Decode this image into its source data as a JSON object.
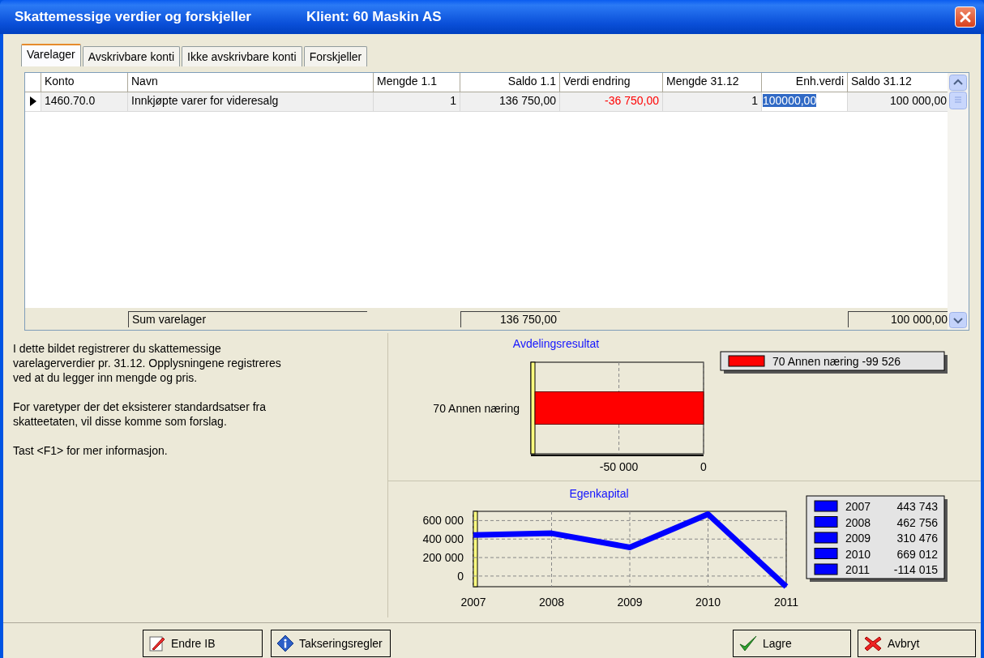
{
  "window": {
    "title": "Skattemessige verdier og forskjeller",
    "client": "Klient: 60  Maskin AS"
  },
  "tabs": [
    {
      "label": "Varelager",
      "selected": true
    },
    {
      "label": "Avskrivbare konti",
      "selected": false
    },
    {
      "label": "Ikke avskrivbare konti",
      "selected": false
    },
    {
      "label": "Forskjeller",
      "selected": false
    }
  ],
  "table": {
    "columns": [
      "Konto",
      "Navn",
      "Mengde 1.1",
      "Saldo 1.1",
      "Verdi endring",
      "Mengde 31.12",
      "Enh.verdi",
      "Saldo 31.12"
    ],
    "rows": [
      {
        "current": true,
        "cells": [
          {
            "text": "1460.70.0",
            "kind": "text"
          },
          {
            "text": "Innkjøpte varer for videresalg",
            "kind": "text"
          },
          {
            "text": "1",
            "kind": "number"
          },
          {
            "text": "136 750,00",
            "kind": "number"
          },
          {
            "text": "-36 750,00",
            "kind": "negative"
          },
          {
            "text": "1",
            "kind": "number"
          },
          {
            "text": "100000,00",
            "kind": "editing"
          },
          {
            "text": "100 000,00",
            "kind": "number"
          }
        ]
      }
    ],
    "footer": {
      "label": "Sum varelager",
      "saldo_1_1": "136 750,00",
      "saldo_31_12": "100 000,00"
    }
  },
  "description": [
    "I dette bildet registrerer du skattemessige varelagerverdier pr. 31.12. Opplysningene registreres ved at du legger inn mengde og pris.",
    "For varetyper der det eksisterer standardsatser fra skatteetaten, vil disse komme som forslag.",
    "Tast <F1> for mer informasjon."
  ],
  "bar_panel": {
    "chart_data": {
      "type": "bar",
      "orientation": "horizontal",
      "title": "Avdelingsresultat",
      "categories": [
        "70 Annen næring"
      ],
      "series": [
        {
          "color": "#ff0000",
          "values": [
            -99526
          ]
        }
      ],
      "xlim": [
        -102000,
        0
      ],
      "xticks": [
        {
          "value": -50000,
          "label": "-50 000"
        },
        0
      ]
    },
    "legend": [
      "70 Annen næring -99 526"
    ]
  },
  "line_panel": {
    "chart_data": {
      "type": "line",
      "title": "Egenkapital",
      "x": [
        "2007",
        "2008",
        "2009",
        "2010",
        "2011"
      ],
      "grid": true,
      "series": [
        {
          "color": "#0000ff",
          "values": [
            443743,
            462756,
            310476,
            669012,
            -114015
          ]
        }
      ],
      "ylim": [
        -115000,
        700000
      ],
      "yticks": [
        0,
        {
          "value": 200000,
          "label": "200 000"
        },
        {
          "value": 400000,
          "label": "400 000"
        },
        {
          "value": 600000,
          "label": "600 000"
        }
      ]
    },
    "legend": [
      {
        "year": "2007",
        "value": "443 743"
      },
      {
        "year": "2008",
        "value": "462 756"
      },
      {
        "year": "2009",
        "value": "310 476"
      },
      {
        "year": "2010",
        "value": "669 012"
      },
      {
        "year": "2011",
        "value": "-114 015"
      }
    ]
  },
  "buttons": [
    {
      "label": "Endre IB"
    },
    {
      "label": "Takseringsregler"
    },
    {
      "label": "Lagre"
    },
    {
      "label": "Avbryt"
    }
  ]
}
